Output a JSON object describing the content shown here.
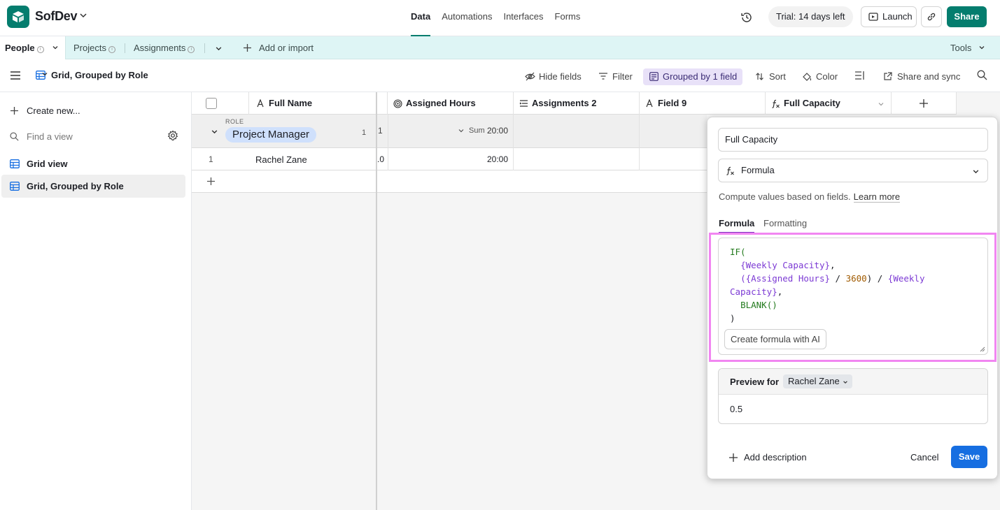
{
  "app": {
    "name": "SofDev"
  },
  "nav": {
    "tabs": [
      "Data",
      "Automations",
      "Interfaces",
      "Forms"
    ],
    "active": "Data"
  },
  "header": {
    "trial": "Trial: 14 days left",
    "launch": "Launch",
    "share": "Share"
  },
  "tables": {
    "items": [
      "People",
      "Projects",
      "Assignments"
    ],
    "active": "People",
    "add": "Add or import",
    "tools": "Tools"
  },
  "viewbar": {
    "view_name": "Grid, Grouped by Role",
    "hide_fields": "Hide fields",
    "filter": "Filter",
    "grouped": "Grouped by 1 field",
    "sort": "Sort",
    "color": "Color",
    "share_sync": "Share and sync"
  },
  "sidebar": {
    "create_new": "Create new...",
    "find_placeholder": "Find a view",
    "views": [
      "Grid view",
      "Grid, Grouped by Role"
    ],
    "selected": "Grid, Grouped by Role"
  },
  "grid": {
    "columns": [
      "Full Name",
      "Assigned Hours",
      "Assignments 2",
      "Field 9",
      "Full Capacity"
    ],
    "group": {
      "label": "ROLE",
      "value": "Project Manager",
      "count": "1",
      "partial": "1",
      "sum_label": "Sum",
      "sum_value": "20:00"
    },
    "rows": [
      {
        "num": "1",
        "name": "Rachel Zane",
        "partial": ".0",
        "assigned_hours": "20:00"
      }
    ]
  },
  "panel": {
    "field_name": "Full Capacity",
    "field_type": "Formula",
    "description": "Compute values based on fields.",
    "learn_more": "Learn more",
    "tabs": [
      "Formula",
      "Formatting"
    ],
    "active_tab": "Formula",
    "formula": {
      "l1": "IF(",
      "l2": "{Weekly Capacity}",
      "l3a": "({Assigned Hours}",
      "l3b": "3600",
      "l3c": "{Weekly",
      "l4": "Capacity}",
      "l5": "BLANK()",
      "l6": ")"
    },
    "ai_button": "Create formula with AI",
    "preview_label": "Preview for",
    "preview_record": "Rachel Zane",
    "preview_value": "0.5",
    "add_description": "Add description",
    "cancel": "Cancel",
    "save": "Save"
  },
  "colors": {
    "brand": "#047d6e",
    "save": "#166ee1",
    "highlight": "#f186f1",
    "grouped_bg": "#e8e1f8",
    "table_bar": "#def5f5"
  }
}
